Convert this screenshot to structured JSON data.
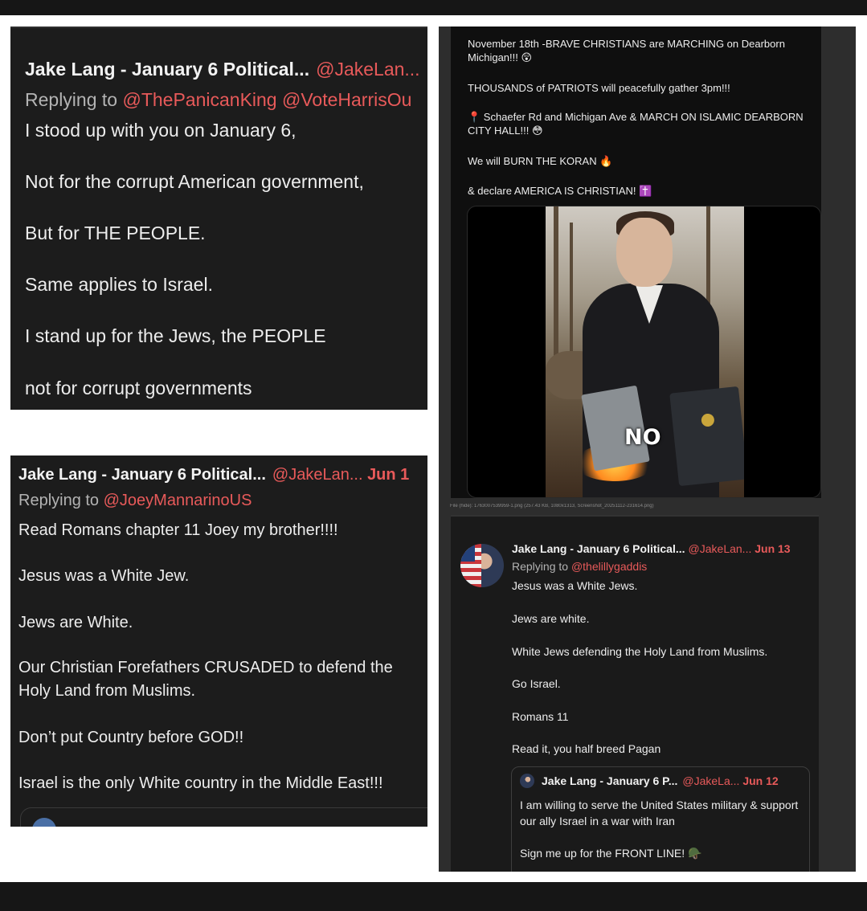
{
  "panel_a": {
    "author": "Jake Lang - January 6 Political...",
    "handle": "@JakeLan...",
    "replying_prefix": "Replying to",
    "replying_to": "@ThePanicanKing @VoteHarrisOu",
    "lines": [
      "I stood up with you on January 6,",
      "Not for the corrupt American government,",
      "But for THE PEOPLE.",
      "Same applies to Israel.",
      "I stand up for the Jews, the PEOPLE",
      "not for corrupt governments"
    ]
  },
  "panel_b": {
    "author": "Jake Lang - January 6 Political...",
    "handle": "@JakeLan...",
    "date": "Jun 1",
    "replying_prefix": "Replying to",
    "replying_to": "@JoeyMannarinoUS",
    "lines": [
      "Read Romans chapter 11 Joey my brother!!!!",
      "Jesus was a White Jew.",
      "Jews are White.",
      "Our Christian Forefathers CRUSADED to defend the Holy Land from Muslims.",
      "Don’t put Country before GOD!!",
      "Israel is the only White country in the Middle East!!!"
    ]
  },
  "panel_c": {
    "lines": [
      "November 18th -BRAVE CHRISTIANS are MARCHING on Dearborn Michigan!!! 😲",
      "THOUSANDS of PATRIOTS will peacefully gather 3pm!!!",
      "📍 Schaefer Rd and Michigan Ave & MARCH ON ISLAMIC DEARBORN CITY HALL!!! 😳",
      "We will BURN THE KORAN 🔥",
      "& declare AMERICA IS CHRISTIAN! ✝️"
    ],
    "video_caption_word": "NO",
    "file_caption": "File (hide): 1763007539959-1.png (257.43 KB, 1080x1313, Screenshot_20251112-231614.png)"
  },
  "panel_d": {
    "author": "Jake Lang - January 6 Political...",
    "handle": "@JakeLan...",
    "date": "Jun 13",
    "replying_prefix": "Replying to",
    "replying_to": "@thelillygaddis",
    "lines": [
      "Jesus was a White Jews.",
      "Jews are white.",
      "White Jews defending the Holy Land from Muslims.",
      "Go Israel.",
      "Romans 11",
      "Read it, you half breed Pagan"
    ],
    "quote": {
      "author": "Jake Lang - January 6 P...",
      "handle": "@JakeLa...",
      "date": "Jun 12",
      "lines": [
        "I am willing to serve the United States military & support our ally Israel in a war with Iran",
        "Sign me up for the FRONT LINE! 🪖"
      ]
    }
  },
  "colors": {
    "accent_red": "#e85a5a",
    "panel_bg": "#1c1c1c",
    "frame": "#161616"
  }
}
